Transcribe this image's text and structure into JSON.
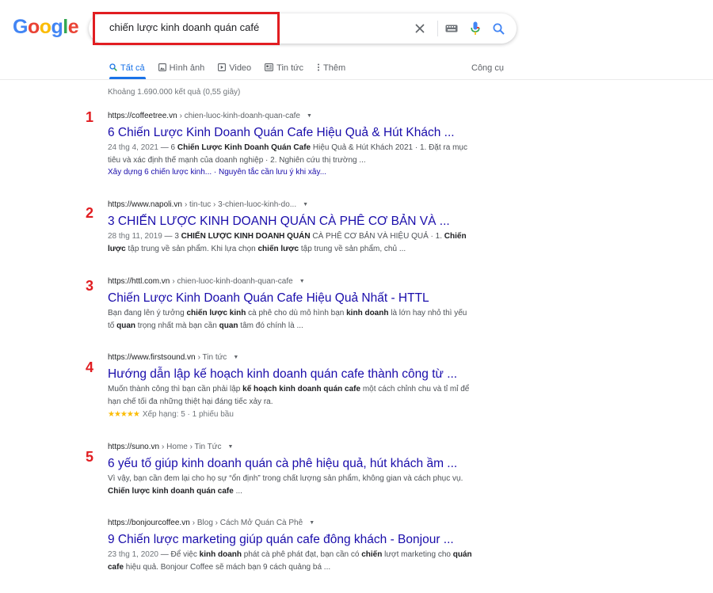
{
  "logo": {
    "letters": [
      "G",
      "o",
      "o",
      "g",
      "l",
      "e"
    ],
    "colors": [
      "#4285f4",
      "#ea4335",
      "#fbbc05",
      "#4285f4",
      "#34a853",
      "#ea4335"
    ]
  },
  "search": {
    "query": "chiến lược kinh doanh quán café"
  },
  "tabs": [
    {
      "label": "Tất cả",
      "icon": "search-icon"
    },
    {
      "label": "Hình ảnh",
      "icon": "image-icon"
    },
    {
      "label": "Video",
      "icon": "video-icon"
    },
    {
      "label": "Tin tức",
      "icon": "news-icon"
    },
    {
      "label": "Thêm",
      "icon": "more-vert-icon"
    }
  ],
  "tools_label": "Công cụ",
  "stats": "Khoảng 1.690.000 kết quả (0,55 giây)",
  "markers": [
    "1",
    "2",
    "3",
    "4",
    "5"
  ],
  "results": [
    {
      "domain": "https://coffeetree.vn",
      "path": "› chien-luoc-kinh-doanh-quan-cafe",
      "title": "6 Chiến Lược Kinh Doanh Quán Cafe Hiệu Quả & Hút Khách ...",
      "date": "24 thg 4, 2021",
      "snippet_html": " — 6 <b>Chiến Lược Kinh Doanh Quán Cafe</b> Hiệu Quả &amp; Hút Khách 2021 · 1. Đặt ra mục tiêu và xác định thế mạnh của doanh nghiệp · 2. Nghiên cứu thị trường ...",
      "sitelinks": [
        "Xây dựng 6 chiến lược kinh...",
        "Nguyên tắc cần lưu ý khi xây..."
      ]
    },
    {
      "domain": "https://www.napoli.vn",
      "path": "› tin-tuc › 3-chien-luoc-kinh-do...",
      "title": "3 CHIẾN LƯỢC KINH DOANH QUÁN CÀ PHÊ CƠ BẢN VÀ ...",
      "date": "28 thg 11, 2019",
      "snippet_html": " — 3 <b>CHIẾN LƯỢC KINH DOANH QUÁN</b> CÀ PHÊ CƠ BẢN VÀ HIỆU QUẢ · 1. <b>Chiến lược</b> tập trung về sản phẩm. Khi lựa chọn <b>chiến lược</b> tập trung về sản phẩm, chủ ..."
    },
    {
      "domain": "https://httl.com.vn",
      "path": "› chien-luoc-kinh-doanh-quan-cafe",
      "title": "Chiến Lược Kinh Doanh Quán Cafe Hiệu Quả Nhất - HTTL",
      "snippet_html": "Bạn đang lên ý tưởng <b>chiến lược kinh</b> cà phê cho dù mô hình bạn <b>kinh doanh</b> là lớn hay nhỏ thì yếu tố <b>quan</b> trọng nhất mà bạn cần <b>quan</b> tâm đó chính là ..."
    },
    {
      "domain": "https://www.firstsound.vn",
      "path": "› Tin tức",
      "title": "Hướng dẫn lập kế hoạch kinh doanh quán cafe thành công từ ...",
      "snippet_html": "Muốn thành công thì bạn cần phải lập <b>kế hoạch kinh doanh quán cafe</b> một cách chỉnh chu và tỉ mỉ để hạn chế tối đa những thiệt hại đáng tiếc xảy ra.",
      "stars": "★★★★★",
      "rating_text": "Xếp hạng: 5 · 1 phiếu bầu"
    },
    {
      "domain": "https://suno.vn",
      "path": "› Home › Tin Tức",
      "title": "6 yếu tố giúp kinh doanh quán cà phê hiệu quả, hút khách ầm ...",
      "snippet_html": "Vì vậy, bạn cần đem lại cho họ sự “ổn định” trong chất lượng sản phẩm, không gian và cách phục vụ. <b>Chiến lược kinh doanh quán cafe</b> ..."
    },
    {
      "domain": "https://bonjourcoffee.vn",
      "path": "› Blog › Cách Mở Quán Cà Phê",
      "title": "9 Chiến lược marketing giúp quán cafe đông khách - Bonjour ...",
      "date": "23 thg 1, 2020",
      "snippet_html": " — Để việc <b>kinh doanh</b> phát cà phê phát đạt, bạn cần có <b>chiến</b> lượt marketing cho <b>quán cafe</b> hiệu quả. Bonjour Coffee sẽ mách bạn 9 cách quảng bá ..."
    }
  ],
  "colors": {
    "link": "#1a0dab",
    "marker": "#e11d21",
    "highlight_box": "#e11d21",
    "tab_active": "#1a73e8"
  }
}
